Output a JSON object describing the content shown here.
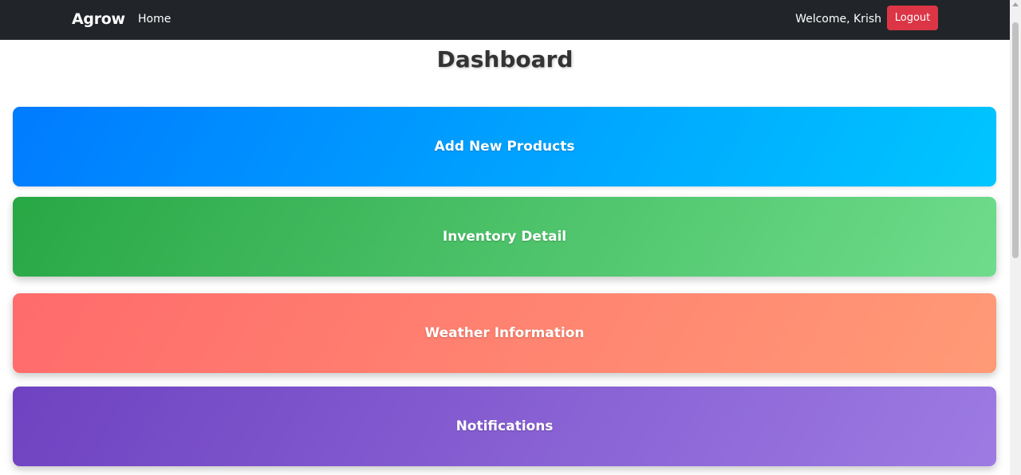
{
  "navbar": {
    "brand": "Agrow",
    "home_link": "Home",
    "welcome_text": "Welcome, Krish",
    "logout_label": "Logout"
  },
  "page": {
    "title": "Dashboard"
  },
  "cards": [
    {
      "label": "Add New Products"
    },
    {
      "label": "Inventory Detail"
    },
    {
      "label": "Weather Information"
    },
    {
      "label": "Notifications"
    }
  ],
  "colors": {
    "navbar_bg": "#212529",
    "logout_bg": "#dc3545",
    "products_gradient": [
      "#007bff",
      "#00c6ff"
    ],
    "inventory_gradient": [
      "#28a745",
      "#6fdc8c"
    ],
    "weather_gradient": [
      "#ff6b6b",
      "#ff9a76"
    ],
    "notifications_gradient": [
      "#6f42c1",
      "#9d7be3"
    ]
  }
}
